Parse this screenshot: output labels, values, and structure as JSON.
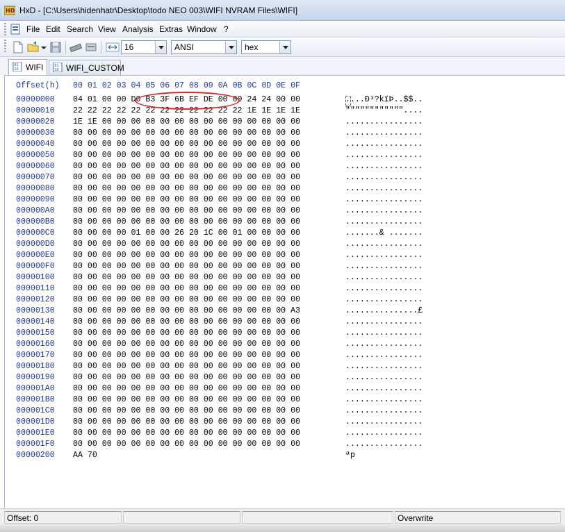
{
  "window": {
    "title": "HxD - [C:\\Users\\hidenhatr\\Desktop\\todo NEO 003\\WIFI NVRAM Files\\WIFI]"
  },
  "menu": {
    "items": [
      "File",
      "Edit",
      "Search",
      "View",
      "Analysis",
      "Extras",
      "Window",
      "?"
    ]
  },
  "toolbar": {
    "bytes_per_row": "16",
    "charset": "ANSI",
    "offset_base": "hex"
  },
  "tabs": [
    {
      "label": "WIFI",
      "active": true
    },
    {
      "label": "WIFI_CUSTOM",
      "active": false
    }
  ],
  "hex_view": {
    "offset_header": "Offset(h)",
    "column_header": "00 01 02 03 04 05 06 07 08 09 0A 0B 0C 0D 0E 0F",
    "offsets": "00000000\n00000010\n00000020\n00000030\n00000040\n00000050\n00000060\n00000070\n00000080\n00000090\n000000A0\n000000B0\n000000C0\n000000D0\n000000E0\n000000F0\n00000100\n00000110\n00000120\n00000130\n00000140\n00000150\n00000160\n00000170\n00000180\n00000190\n000001A0\n000001B0\n000001C0\n000001D0\n000001E0\n000001F0\n00000200",
    "hex": "04 01 00 00 D0 B3 3F 6B EF DE 00 00 24 24 00 00\n22 22 22 22 22 22 22 22 22 22 22 22 1E 1E 1E 1E\n1E 1E 00 00 00 00 00 00 00 00 00 00 00 00 00 00\n00 00 00 00 00 00 00 00 00 00 00 00 00 00 00 00\n00 00 00 00 00 00 00 00 00 00 00 00 00 00 00 00\n00 00 00 00 00 00 00 00 00 00 00 00 00 00 00 00\n00 00 00 00 00 00 00 00 00 00 00 00 00 00 00 00\n00 00 00 00 00 00 00 00 00 00 00 00 00 00 00 00\n00 00 00 00 00 00 00 00 00 00 00 00 00 00 00 00\n00 00 00 00 00 00 00 00 00 00 00 00 00 00 00 00\n00 00 00 00 00 00 00 00 00 00 00 00 00 00 00 00\n00 00 00 00 00 00 00 00 00 00 00 00 00 00 00 00\n00 00 00 00 01 00 00 26 20 1C 00 01 00 00 00 00\n00 00 00 00 00 00 00 00 00 00 00 00 00 00 00 00\n00 00 00 00 00 00 00 00 00 00 00 00 00 00 00 00\n00 00 00 00 00 00 00 00 00 00 00 00 00 00 00 00\n00 00 00 00 00 00 00 00 00 00 00 00 00 00 00 00\n00 00 00 00 00 00 00 00 00 00 00 00 00 00 00 00\n00 00 00 00 00 00 00 00 00 00 00 00 00 00 00 00\n00 00 00 00 00 00 00 00 00 00 00 00 00 00 00 A3\n00 00 00 00 00 00 00 00 00 00 00 00 00 00 00 00\n00 00 00 00 00 00 00 00 00 00 00 00 00 00 00 00\n00 00 00 00 00 00 00 00 00 00 00 00 00 00 00 00\n00 00 00 00 00 00 00 00 00 00 00 00 00 00 00 00\n00 00 00 00 00 00 00 00 00 00 00 00 00 00 00 00\n00 00 00 00 00 00 00 00 00 00 00 00 00 00 00 00\n00 00 00 00 00 00 00 00 00 00 00 00 00 00 00 00\n00 00 00 00 00 00 00 00 00 00 00 00 00 00 00 00\n00 00 00 00 00 00 00 00 00 00 00 00 00 00 00 00\n00 00 00 00 00 00 00 00 00 00 00 00 00 00 00 00\n00 00 00 00 00 00 00 00 00 00 00 00 00 00 00 00\n00 00 00 00 00 00 00 00 00 00 00 00 00 00 00 00\nAA 70",
    "text": "....Ð³?kïÞ..$$..\n\"\"\"\"\"\"\"\"\"\"\"\"....\n................\n................\n................\n................\n................\n................\n................\n................\n................\n................\n.......& .......\n................\n................\n................\n................\n................\n................\n...............£\n................\n................\n................\n................\n................\n................\n................\n................\n................\n................\n................\n................\nªp"
  },
  "status": {
    "offset": "Offset: 0",
    "mode": "Overwrite"
  },
  "colors": {
    "offset_color": "#1c3a9c",
    "highlight_ellipse": "#d62a2a"
  }
}
